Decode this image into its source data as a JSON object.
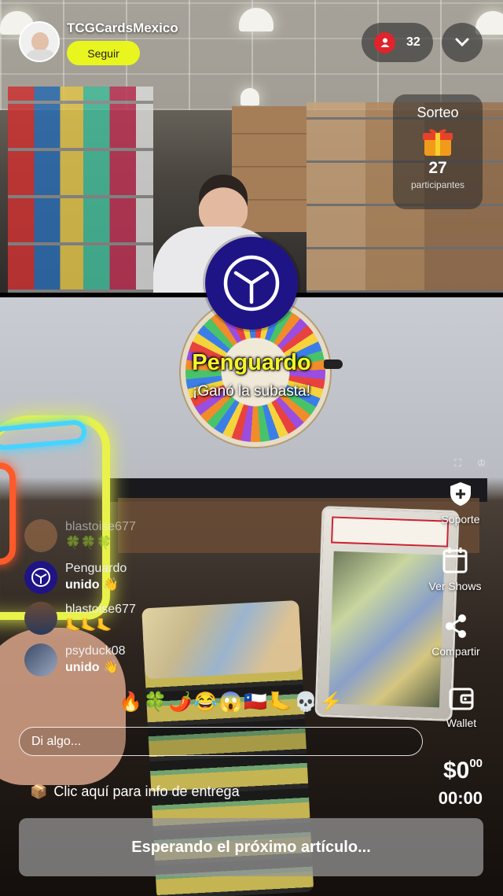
{
  "host": {
    "name": "TCGCardsMexico",
    "follow_label": "Seguir"
  },
  "viewers": {
    "count": "32"
  },
  "raffle": {
    "title": "Sorteo",
    "count": "27",
    "label": "participantes"
  },
  "winner": {
    "name": "Penguardo",
    "message": "¡Ganó la subasta!"
  },
  "actions": [
    {
      "label": "Soporte",
      "icon": "shield-plus-icon"
    },
    {
      "label": "Ver Shows",
      "icon": "calendar-icon"
    },
    {
      "label": "Compartir",
      "icon": "share-icon"
    },
    {
      "label": "Wallet",
      "icon": "wallet-icon"
    }
  ],
  "chat": [
    {
      "user": "blastoise677",
      "message": "🍀🍀🍀"
    },
    {
      "user": "Penguardo",
      "message": "unido 👋"
    },
    {
      "user": "blastoise677",
      "message": "🦶🦶🦶"
    },
    {
      "user": "psyduck08",
      "message": "unido 👋"
    }
  ],
  "reactions": "🔥🍀🌶️😂😱🇨🇱🦶💀⚡",
  "input": {
    "placeholder": "Di algo..."
  },
  "delivery": {
    "icon": "📦",
    "text": "Clic aquí para info de entrega"
  },
  "auction": {
    "price": "$0",
    "cents": "00",
    "timer": "00:00",
    "status": "Esperando el próximo artículo..."
  },
  "colors": {
    "follow": "#e9f51f",
    "winner": "#f5f52a",
    "brand": "#1f1486",
    "viewer_dot": "#e0242b"
  }
}
